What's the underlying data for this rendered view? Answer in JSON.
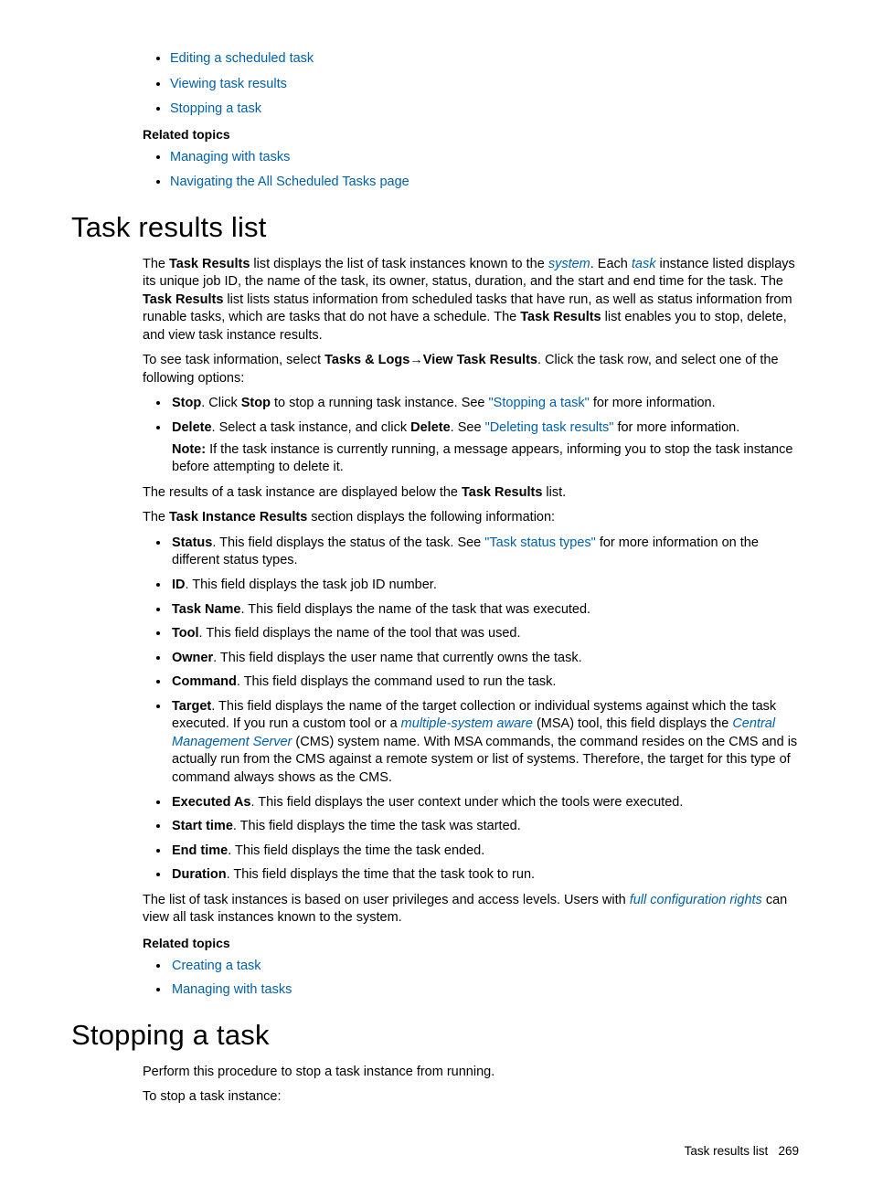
{
  "topLinks": [
    "Editing a scheduled task",
    "Viewing task results",
    "Stopping a task"
  ],
  "relatedTopicsLabel": "Related topics",
  "relatedTopics1": [
    "Managing with tasks",
    "Navigating the All Scheduled Tasks page"
  ],
  "section1": {
    "heading": "Task results list",
    "para1": {
      "t1": "The ",
      "b1": "Task Results",
      "t2": " list displays the list of task instances known to the ",
      "link1": "system",
      "t3": ". Each ",
      "link2": "task",
      "t4": " instance listed displays its unique job ID, the name of the task, its owner, status, duration, and the start and end time for the task. The ",
      "b2": "Task Results",
      "t5": " list lists status information from scheduled tasks that have run, as well as status information from runable tasks, which are tasks that do not have a schedule. The ",
      "b3": "Task Results",
      "t6": " list enables you to stop, delete, and view task instance results."
    },
    "para2": {
      "t1": "To see task information, select ",
      "b1": "Tasks & Logs",
      "arrow": "→",
      "b2": "View Task Results",
      "t2": ". Click the task row, and select one of the following options:"
    },
    "options": {
      "stop": {
        "b1": "Stop",
        "t1": ". Click ",
        "b2": "Stop",
        "t2": " to stop a running task instance. See ",
        "link": "\"Stopping a task\"",
        "t3": " for more information."
      },
      "delete": {
        "b1": "Delete",
        "t1": ". Select a task instance, and click ",
        "b2": "Delete",
        "t2": ". See ",
        "link": "\"Deleting task results\"",
        "t3": " for more information.",
        "noteLabel": "Note:",
        "noteText": " If the task instance is currently running, a message appears, informing you to stop the task instance before attempting to delete it."
      }
    },
    "para3": {
      "t1": "The results of a task instance are displayed below the ",
      "b1": "Task Results",
      "t2": " list."
    },
    "para4": {
      "t1": "The ",
      "b1": "Task Instance Results",
      "t2": " section displays the following information:"
    },
    "fields": {
      "status": {
        "b": "Status",
        "t1": ". This field displays the status of the task. See ",
        "link": "\"Task status types\"",
        "t2": " for more information on the different status types."
      },
      "id": {
        "b": "ID",
        "t": ". This field displays the task job ID number."
      },
      "taskName": {
        "b": "Task Name",
        "t": ". This field displays the name of the task that was executed."
      },
      "tool": {
        "b": "Tool",
        "t": ". This field displays the name of the tool that was used."
      },
      "owner": {
        "b": "Owner",
        "t": ". This field displays the user name that currently owns the task."
      },
      "command": {
        "b": "Command",
        "t": ". This field displays the command used to run the task."
      },
      "target": {
        "b": "Target",
        "t1": ". This field displays the name of the target collection or individual systems against which the task executed. If you run a custom tool or a ",
        "link1": "multiple-system aware",
        "t2": " (MSA) tool, this field displays the ",
        "link2": "Central Management Server",
        "t3": " (CMS) system name. With MSA commands, the command resides on the CMS and is actually run from the CMS against a remote system or list of systems. Therefore, the target for this type of command always shows as the CMS."
      },
      "executedAs": {
        "b": "Executed As",
        "t": ". This field displays the user context under which the tools were executed."
      },
      "startTime": {
        "b": "Start time",
        "t": ". This field displays the time the task was started."
      },
      "endTime": {
        "b": "End time",
        "t": ". This field displays the time the task ended."
      },
      "duration": {
        "b": "Duration",
        "t": ". This field displays the time that the task took to run."
      }
    },
    "para5": {
      "t1": "The list of task instances is based on user privileges and access levels. Users with ",
      "link": "full configuration rights",
      "t2": " can view all task instances known to the system."
    },
    "relatedTopics2": [
      "Creating a task",
      "Managing with tasks"
    ]
  },
  "section2": {
    "heading": "Stopping a task",
    "para1": "Perform this procedure to stop a task instance from running.",
    "para2": "To stop a task instance:"
  },
  "footer": {
    "title": "Task results list",
    "pageNum": "269"
  }
}
